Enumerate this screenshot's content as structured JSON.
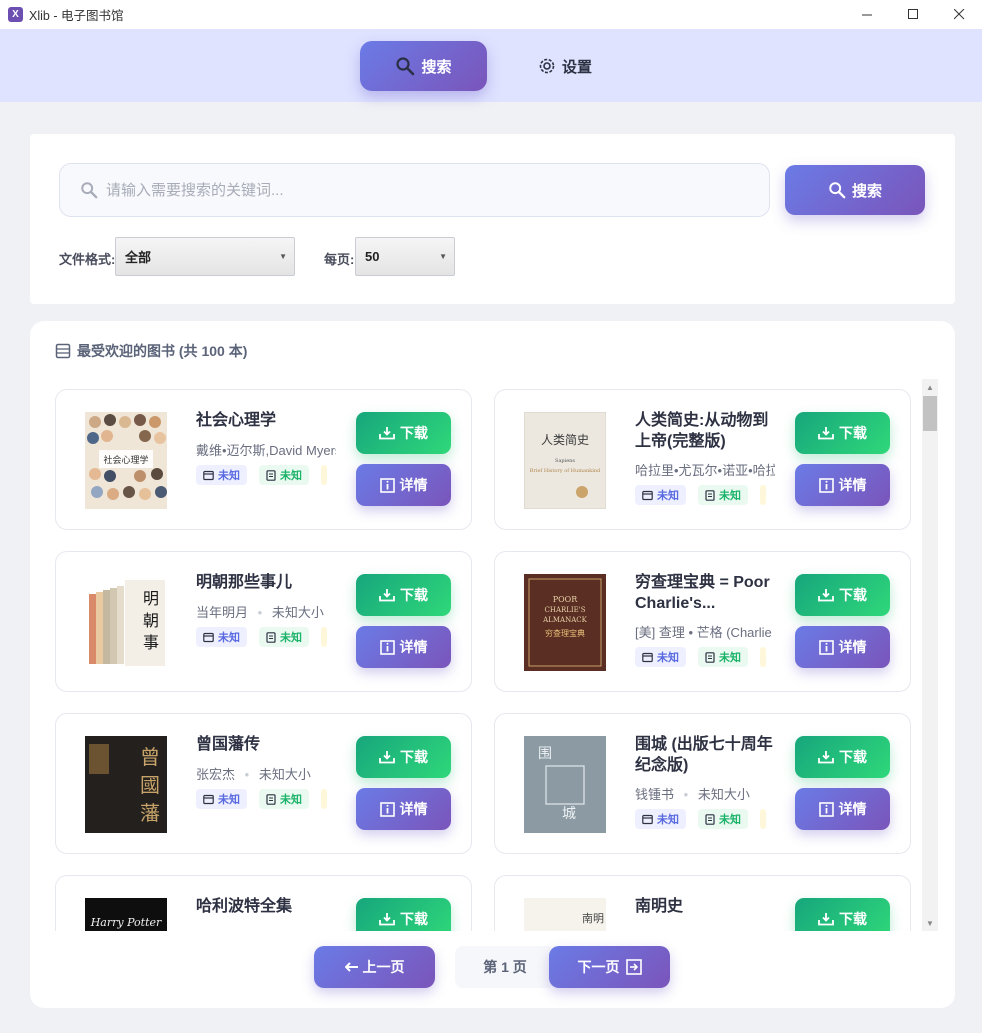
{
  "window": {
    "title": "Xlib - 电子图书馆",
    "icon_letter": "X"
  },
  "nav": {
    "search_label": "搜索",
    "settings_label": "设置"
  },
  "search": {
    "placeholder": "请输入需要搜索的关键词...",
    "button_label": "搜索",
    "format_label": "文件格式:",
    "format_value": "全部",
    "perpage_label": "每页:",
    "perpage_value": "50"
  },
  "results": {
    "header": "最受欢迎的图书 (共 100 本)",
    "download_label": "下载",
    "details_label": "详情",
    "format_chip": "未知",
    "size_chip": "未知",
    "books": [
      {
        "title": "社会心理学",
        "author": "戴维•迈尔斯,David Myers",
        "size": ""
      },
      {
        "title": "人类简史:从动物到上帝(完整版)",
        "author": "哈拉里•尤瓦尔•诺亚•哈拉里",
        "size": ""
      },
      {
        "title": "明朝那些事儿",
        "author": "当年明月",
        "size": "未知大小"
      },
      {
        "title": "穷查理宝典 = Poor Charlie's...",
        "author": "[美] 查理 • 芒格 (Charlie Munger)",
        "size": ""
      },
      {
        "title": "曾国藩传",
        "author": "张宏杰",
        "size": "未知大小"
      },
      {
        "title": "围城 (出版七十周年纪念版)",
        "author": "钱锺书",
        "size": "未知大小"
      },
      {
        "title": "哈利波特全集",
        "author": "",
        "size": ""
      },
      {
        "title": "南明史",
        "author": "",
        "size": ""
      }
    ]
  },
  "pagination": {
    "prev_label": "上一页",
    "page_label": "第 1 页",
    "next_label": "下一页"
  },
  "colors": {
    "accent_purple": "#7a55ba",
    "accent_blue": "#6b7be6",
    "download_green": "#2fd87a",
    "nav_background": "#dfe3ff"
  },
  "cover_texts": {
    "c1": "社会心理学",
    "c2_title": "人类简史",
    "c2_sub": "Sapiens",
    "c2_en": "Brief History of Humankind",
    "c4_l1": "POOR",
    "c4_l2": "CHARLIE'S",
    "c4_l3": "ALMANACK",
    "c4_cn": "穷查理宝典",
    "c5_a": "曾",
    "c5_b": "國",
    "c5_c": "藩",
    "c6_a": "围",
    "c6_b": "城",
    "c7": "Harry Potter",
    "c8": "南明"
  }
}
